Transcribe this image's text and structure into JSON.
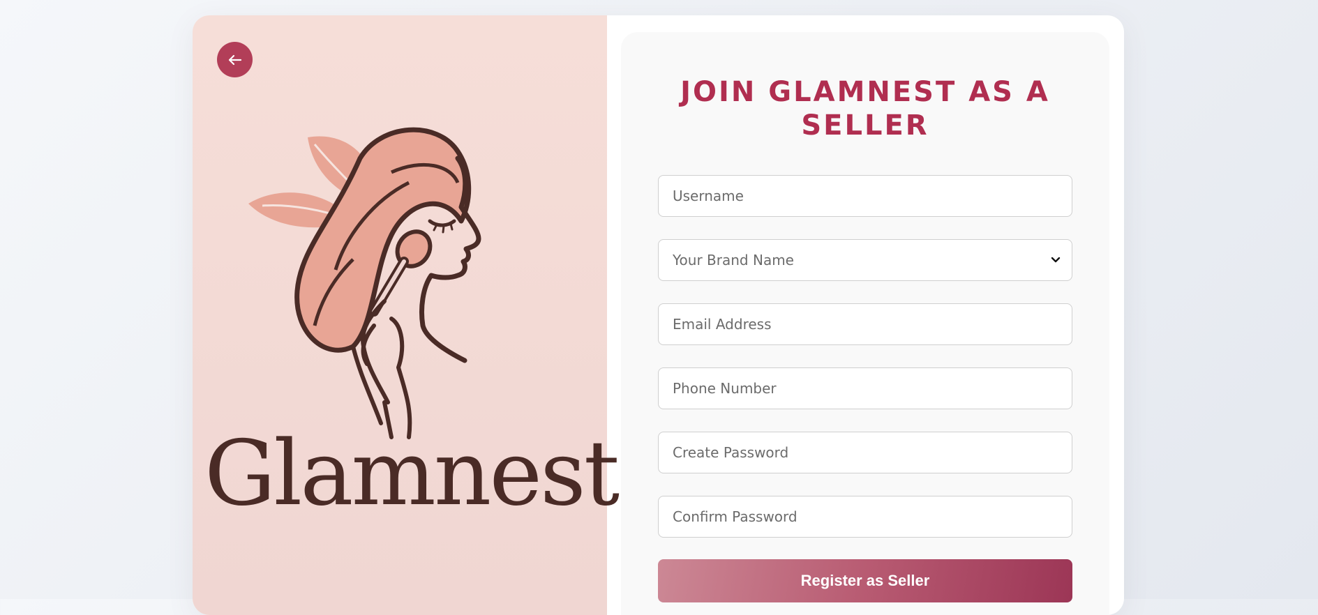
{
  "brand": {
    "name": "Glamnest"
  },
  "form": {
    "title": "JOIN GLAMNEST AS A SELLER",
    "username_placeholder": "Username",
    "brand_select_value": "Your Brand Name",
    "email_placeholder": "Email Address",
    "phone_placeholder": "Phone Number",
    "password_placeholder": "Create Password",
    "confirm_password_placeholder": "Confirm Password",
    "submit_label": "Register as Seller"
  },
  "icons": {
    "back": "arrow-left-icon",
    "select": "chevron-down-icon",
    "logo": "woman-profile-makeup-brush-logo"
  },
  "colors": {
    "accent": "#b02e50",
    "back_button": "#b23e58",
    "left_panel": "#f4dbd6",
    "logo_ink": "#4a2b26",
    "logo_fill": "#e8a595"
  }
}
